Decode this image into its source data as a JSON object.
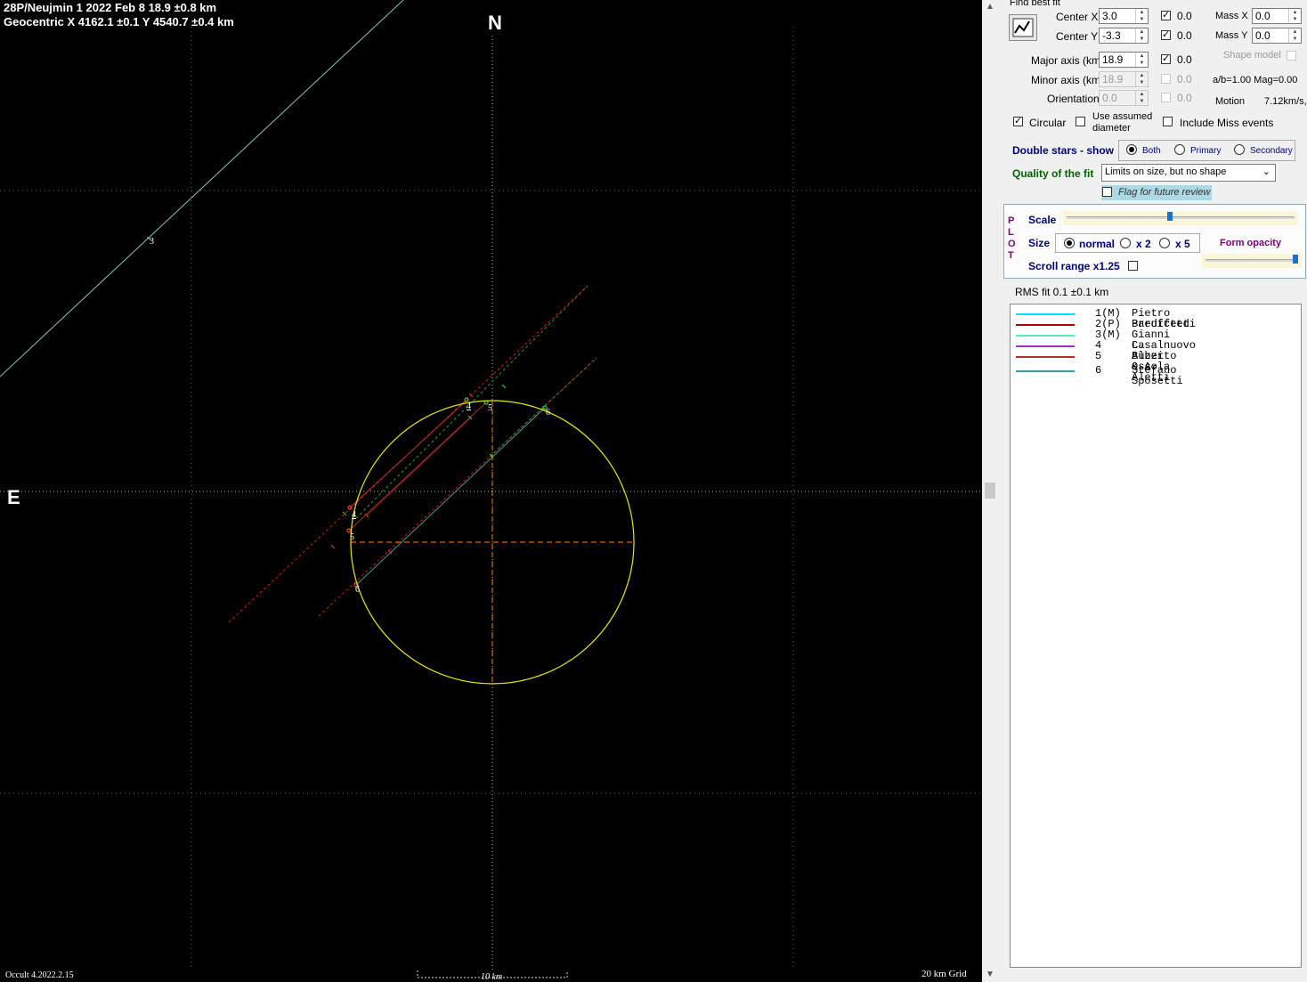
{
  "plot": {
    "title_line1": "28P/Neujmin 1  2022 Feb 8   18.9 ±0.8 km",
    "title_line2": "Geocentric  X  4162.1 ±0.1  Y 4540.7 ±0.4 km",
    "north_label": "N",
    "east_label": "E",
    "version": "Occult 4.2022.2.15",
    "scale_bar_label": "10 km",
    "grid_label": "20 km Grid",
    "chord_labels": [
      "3",
      "4",
      "5",
      "6",
      "4",
      "5",
      "6"
    ]
  },
  "panel": {
    "find_best_fit": "Find best fit",
    "center_x_label": "Center X",
    "center_x_value": "3.0",
    "center_x_check_value": "0.0",
    "center_y_label": "Center Y",
    "center_y_value": "-3.3",
    "center_y_check_value": "0.0",
    "mass_x_label": "Mass X",
    "mass_x_value": "0.0",
    "mass_y_label": "Mass Y",
    "mass_y_value": "0.0",
    "shape_model_label": "Shape model",
    "major_axis_label": "Major axis (km)",
    "major_axis_value": "18.9",
    "major_check_value": "0.0",
    "minor_axis_label": "Minor axis (km)",
    "minor_axis_value": "18.9",
    "minor_check_value": "0.0",
    "ab_mag_text": "a/b=1.00  Mag=0.00",
    "orientation_label": "Orientation",
    "orientation_value": "0.0",
    "orientation_check_value": "0.0",
    "motion_label": "Motion",
    "motion_value": "7.12km/s,",
    "circular_label": "Circular",
    "use_assumed_label": "Use assumed diameter",
    "include_miss_label": "Include Miss events",
    "double_stars_label": "Double stars - show",
    "ds_both": "Both",
    "ds_primary": "Primary",
    "ds_secondary": "Secondary",
    "quality_label": "Quality of the fit",
    "quality_value": "Limits on size, but no shape",
    "flag_label": "Flag for future review",
    "plot_vertical": [
      "P",
      "L",
      "O",
      "T"
    ],
    "scale_label": "Scale",
    "size_label": "Size",
    "size_normal": "normal",
    "size_x2": "x 2",
    "size_x5": "x 5",
    "form_opacity_label": "Form opacity",
    "scroll_range_label": "Scroll range x1.25",
    "scale_level": 0.45,
    "opacity_level": 1.0,
    "rms_fit": "RMS fit 0.1 ±0.1 km"
  },
  "legend": [
    {
      "id": "1(M)",
      "name": "Pietro Baruffetti",
      "color": "#00e0ff"
    },
    {
      "id": "2(P)",
      "name": "Predicted",
      "color": "#b00000"
    },
    {
      "id": "3(M)",
      "name": "Gianni Casalnuovo",
      "color": "#60e8c0"
    },
    {
      "id": "4",
      "name": "L. Buzzi & A. Aletti",
      "color": "#9933cc"
    },
    {
      "id": "5",
      "name": "Alberto Ossola",
      "color": "#b03030"
    },
    {
      "id": "6",
      "name": "Stefano Sposetti",
      "color": "#3a9a9a"
    }
  ]
}
